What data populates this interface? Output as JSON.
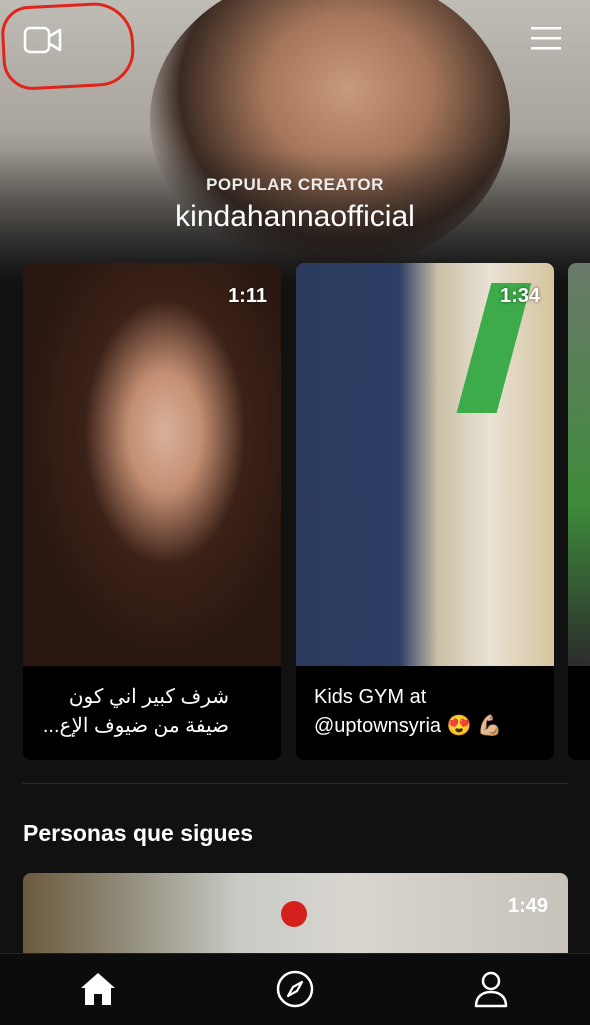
{
  "header": {
    "camera_icon": "video-camera-icon",
    "menu_icon": "hamburger-menu-icon",
    "annotation_color": "#e0241b"
  },
  "hero": {
    "tag": "POPULAR CREATOR",
    "name": "kindahannaofficial"
  },
  "videos": [
    {
      "duration": "1:11",
      "caption": "شرف كبير اني كون ضيفة من ضيوف الإع..."
    },
    {
      "duration": "1:34",
      "caption": "Kids GYM at @uptownsyria 😍 💪🏼"
    }
  ],
  "following": {
    "title": "Personas que sigues",
    "duration": "1:49"
  },
  "nav": {
    "items": [
      "home-icon",
      "compass-icon",
      "profile-icon"
    ]
  }
}
